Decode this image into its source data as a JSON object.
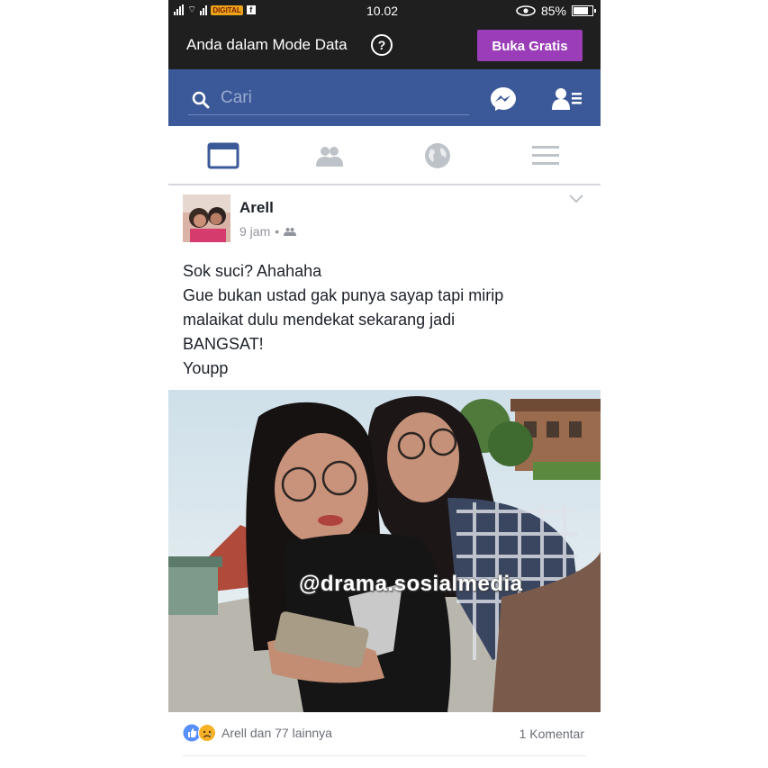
{
  "status_bar": {
    "time": "10.02",
    "battery": "85%",
    "carrier_badge": "DIGITAL"
  },
  "data_mode": {
    "message": "Anda dalam Mode Data",
    "help": "?",
    "button_label": "Buka Gratis"
  },
  "search": {
    "placeholder": "Cari"
  },
  "post": {
    "author": "Arell",
    "time": "9 jam",
    "separator": "•",
    "text_lines": [
      "Sok suci? Ahahaha",
      "Gue bukan ustad gak punya sayap tapi mirip",
      "malaikat dulu mendekat sekarang jadi",
      "BANGSAT!",
      "Youpp"
    ],
    "watermark": "@drama.sosialmedia",
    "reactions_text": "Arell dan 77 lainnya",
    "comments_text": "1 Komentar"
  },
  "colors": {
    "facebook_blue": "#3b5998",
    "data_bar": "#1f1f1f",
    "button_purple": "#9b3db8"
  }
}
